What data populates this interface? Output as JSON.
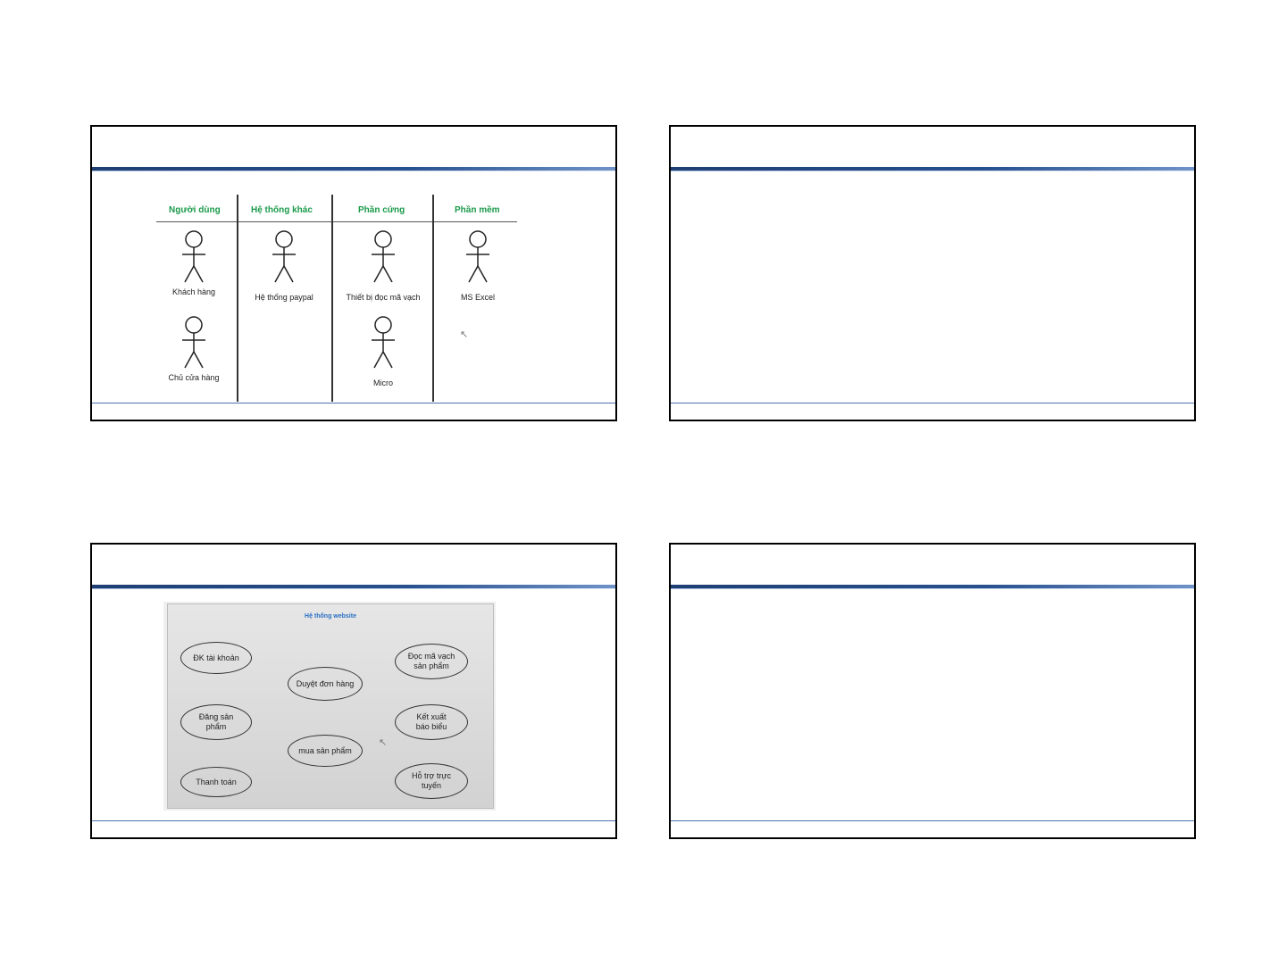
{
  "slides": [
    {
      "title": "",
      "actor_table": {
        "columns": [
          {
            "header": "Người dùng",
            "actors": [
              "Khách hàng",
              "Chủ cửa hàng"
            ]
          },
          {
            "header": "Hệ thống khác",
            "actors": [
              "Hệ thống paypal"
            ]
          },
          {
            "header": "Phần cứng",
            "actors": [
              "Thiết bị đọc mã vạch",
              "Micro"
            ]
          },
          {
            "header": "Phần mềm",
            "actors": [
              "MS Excel"
            ]
          }
        ]
      }
    },
    {
      "title": ""
    },
    {
      "title": "",
      "use_case_diagram": {
        "system_name": "Hệ thống website",
        "use_cases": [
          "ĐK tài khoản",
          "Duyệt đơn hàng",
          "Đọc mã vạch sản phẩm",
          "Đăng sản phẩm",
          "Kết xuất báo biểu",
          "mua sản phẩm",
          "Thanh toán",
          "Hỗ trợ trực tuyến"
        ]
      }
    },
    {
      "title": ""
    }
  ],
  "colors": {
    "header_green": "#1a9a4a",
    "title_rule_blue": "#27508f",
    "diagram_title_blue": "#2a6fc4"
  }
}
